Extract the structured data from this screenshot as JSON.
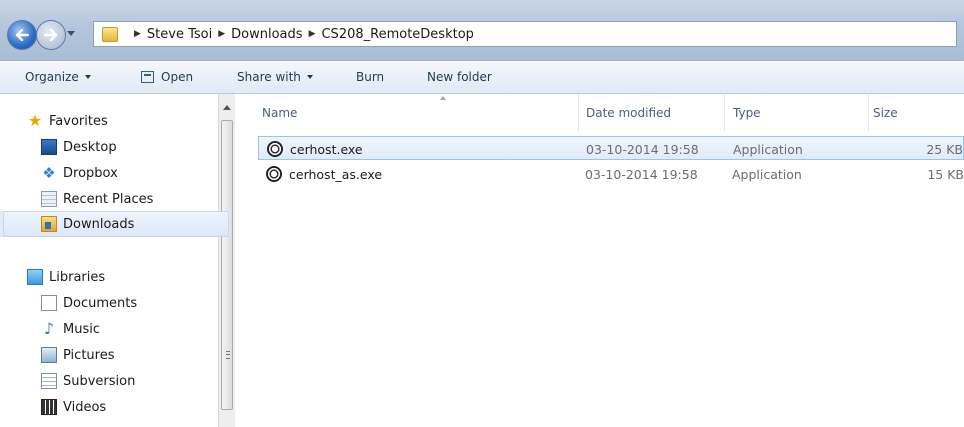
{
  "address": {
    "crumbs": [
      "Steve Tsoi",
      "Downloads",
      "CS208_RemoteDesktop"
    ]
  },
  "toolbar": {
    "organize": "Organize",
    "open": "Open",
    "share_with": "Share with",
    "burn": "Burn",
    "new_folder": "New folder"
  },
  "navigation": {
    "favorites": "Favorites",
    "desktop": "Desktop",
    "dropbox": "Dropbox",
    "recent_places": "Recent Places",
    "downloads": "Downloads",
    "libraries": "Libraries",
    "documents": "Documents",
    "music": "Music",
    "pictures": "Pictures",
    "subversion": "Subversion",
    "videos": "Videos",
    "selected": "Downloads"
  },
  "columns": {
    "name": "Name",
    "date_modified": "Date modified",
    "type": "Type",
    "size": "Size"
  },
  "files": [
    {
      "name": "cerhost.exe",
      "date": "03-10-2014 19:58",
      "type": "Application",
      "size": "25 KB",
      "selected": true
    },
    {
      "name": "cerhost_as.exe",
      "date": "03-10-2014 19:58",
      "type": "Application",
      "size": "15 KB",
      "selected": false
    }
  ],
  "colors": {
    "selection_fill": "#dfecfb",
    "selection_border": "#99c3f0",
    "toolbar_text": "#1e395b"
  },
  "icons": {
    "back": "back-arrow-icon",
    "forward": "forward-arrow-icon",
    "app": "application-icon"
  }
}
